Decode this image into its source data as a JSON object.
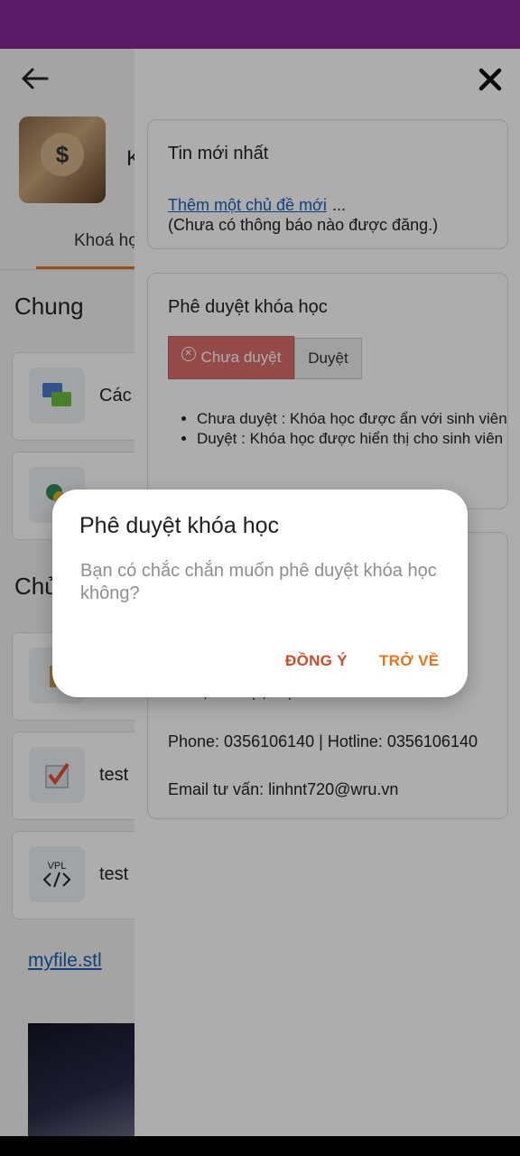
{
  "background": {
    "course_title_fragment": "K",
    "tab_label": "Khoá họ",
    "section_general": "Chung",
    "section_topic": "Chủ",
    "cards": [
      {
        "label": "Các",
        "icon": "chat-icon"
      },
      {
        "label": "",
        "icon": "forum-icon"
      },
      {
        "label": "",
        "icon": "book-icon"
      },
      {
        "label": "test",
        "icon": "assignment-icon"
      },
      {
        "label": "test",
        "icon": "vpl-icon"
      }
    ],
    "vpl_icon_text": "VPL",
    "file_link": "myfile.stl"
  },
  "drawer": {
    "news": {
      "title": "Tin mới nhất",
      "add_topic_link": "Thêm một chủ đề mới",
      "ellipsis": "...",
      "empty_text": "(Chưa có thông báo nào được đăng.)"
    },
    "approval": {
      "title": "Phê duyệt khóa học",
      "btn_unapproved": "Chưa duyệt",
      "btn_approved": "Duyệt",
      "bullets": [
        "Chưa duyệt : Khóa học được ẩn với sinh viên",
        "Duyệt : Khóa học được hiển thị cho sinh viên"
      ]
    },
    "contact": {
      "address_fragment": "Liêm, Hà Nội, Việt Nam",
      "phone_line": "Phone: 0356106140 | Hotline: 0356106140",
      "email_line": "Email tư vấn: linhnt720@wru.vn"
    }
  },
  "dialog": {
    "title": "Phê duyệt khóa học",
    "message": "Bạn có chắc chắn muốn phê duyệt khóa học không?",
    "agree": "ĐỒNG Ý",
    "back": "TRỞ VỀ"
  },
  "colors": {
    "status_bar": "#5a1a66",
    "accent_orange": "#e8731c",
    "agree_red": "#d04a2a",
    "unapproved_red": "#dc6e6e",
    "link_blue": "#1a5fb4"
  }
}
